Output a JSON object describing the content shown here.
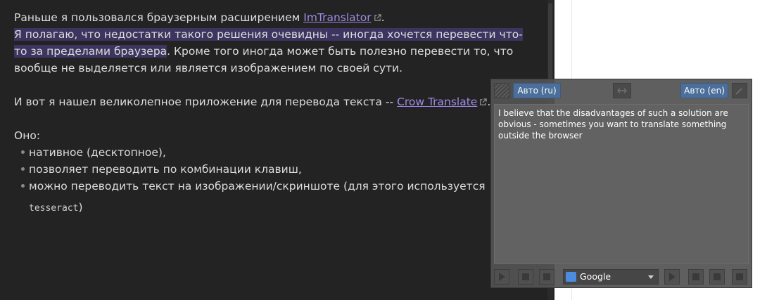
{
  "note": {
    "line1_text": "Раньше я пользовался браузерным расширением ",
    "line1_link": "ImTranslator",
    "line1_end": ".",
    "line2_text": "Я полагаю, что недостатки такого решения очевидны -- иногда хочется перевести что-",
    "line3_hl": "то за пределами браузера",
    "line3_rest": ". Кроме того иногда может быть полезно перевести то, что",
    "line4_text": "вообще не выделяется или является изображением по своей сути.",
    "line5_text": "И вот я нашел великолепное приложение для перевода текста -- ",
    "line5_link": "Crow Translate",
    "line5_end": ".",
    "line6_text": "Оно:",
    "bullets": [
      "нативное (десктопное),",
      "позволяет переводить по комбинации клавиш,",
      "можно переводить текст на изображении/скриншоте (для этого используется"
    ],
    "code_text": "tesseract",
    "code_end": ")"
  },
  "popup": {
    "source_lang": "Авто (ru)",
    "target_lang": "Авто (en)",
    "translation": "I believe that the disadvantages of such a solution are obvious - sometimes you want to translate something outside the browser",
    "engine": "Google"
  },
  "colors": {
    "accent_link": "#a08ae6",
    "highlight": "#3d3560",
    "lang_button": "#4b6f9a"
  }
}
